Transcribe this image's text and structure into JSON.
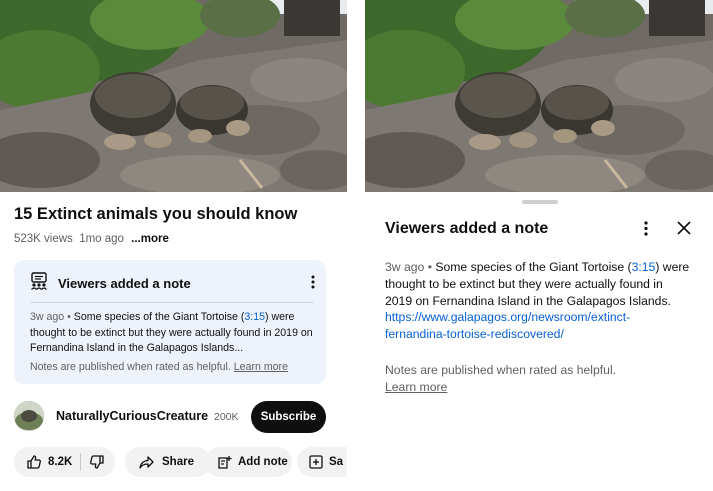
{
  "left": {
    "video": {
      "alt": "two giant tortoises on lava rock"
    },
    "title": "15 Extinct animals you should know",
    "views": "523K views",
    "age": "1mo ago",
    "more": "...more",
    "note": {
      "heading": "Viewers added a note",
      "ago": "3w ago",
      "sep": "•",
      "text_a": "Some species of the Giant Tortoise (",
      "timestamp": "3:15",
      "text_b": ") were thought to be extinct but they were actually found in 2019 on Fernandina Island in the Galapagos Islands...",
      "footer_text": "Notes are published when rated as helpful.",
      "learn_more": "Learn more"
    },
    "channel": {
      "name": "NaturallyCuriousCreature",
      "subscribers": "200K",
      "subscribe_label": "Subscribe"
    },
    "actions": {
      "likes": "8.2K",
      "share": "Share",
      "add_note": "Add note",
      "save_partial": "Sa"
    }
  },
  "right": {
    "sheet": {
      "title": "Viewers added a note",
      "ago": "3w ago",
      "sep": "•",
      "text_a": "Some species of the Giant Tortoise (",
      "timestamp": "3:15",
      "text_b": ") were thought to be extinct but they were actually found in 2019 on Fernandina Island in the Galapagos Islands.",
      "url": "https://www.galapagos.org/newsroom/extinct-fernandina-tortoise-rediscovered/",
      "footer_text": "Notes are published when rated as helpful.",
      "learn_more": "Learn more"
    }
  },
  "colors": {
    "link": "#065fd4",
    "card_bg": "#eef3fb",
    "subscribe_bg": "#0f0f0f",
    "muted": "#606060"
  }
}
